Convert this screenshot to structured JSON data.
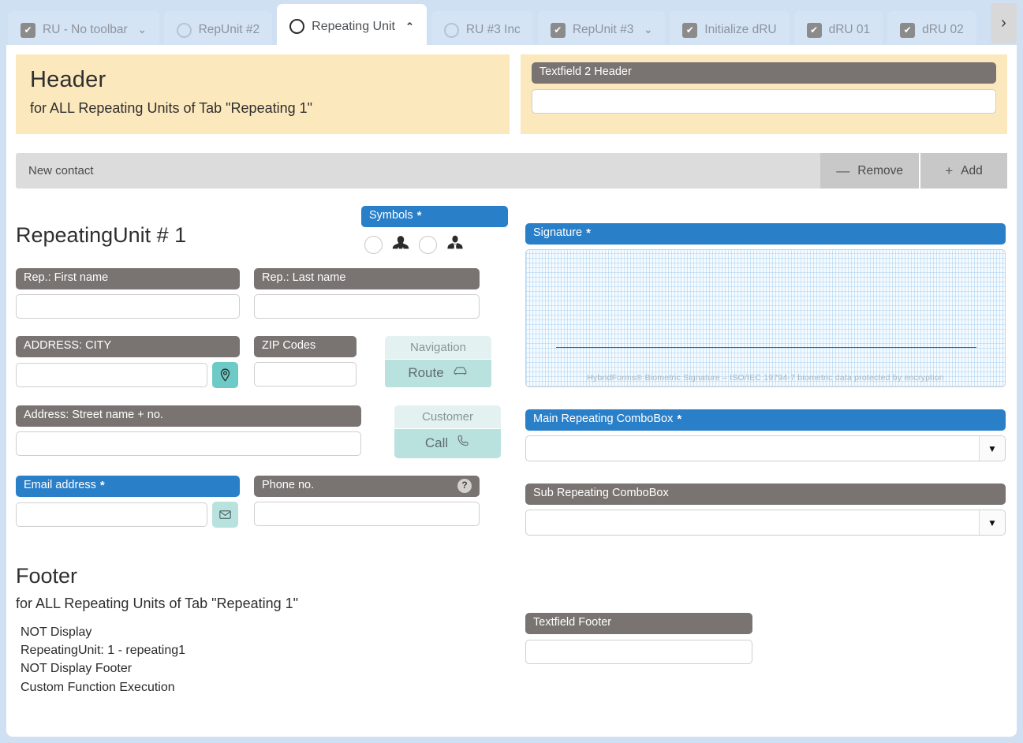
{
  "tabs": [
    {
      "label": "RU - No toolbar",
      "mark": "checkbox-checked-icon",
      "chevron": "chevron-down-icon",
      "active": false
    },
    {
      "label": "RepUnit #2",
      "mark": "circle-icon",
      "chevron": "",
      "active": false
    },
    {
      "label": "Repeating Unit",
      "mark": "circle-icon",
      "chevron": "chevron-up-icon",
      "active": true
    },
    {
      "label": "RU #3 Inc",
      "mark": "circle-icon",
      "chevron": "",
      "active": false
    },
    {
      "label": "RepUnit #3",
      "mark": "checkbox-checked-icon",
      "chevron": "chevron-down-icon",
      "active": false
    },
    {
      "label": "Initialize dRU",
      "mark": "checkbox-checked-icon",
      "chevron": "",
      "active": false
    },
    {
      "label": "dRU 01",
      "mark": "checkbox-checked-icon",
      "chevron": "",
      "active": false
    },
    {
      "label": "dRU 02",
      "mark": "checkbox-checked-icon",
      "chevron": "",
      "active": false
    }
  ],
  "tabbar": {
    "scroll_right_icon": "chevron-right-icon",
    "checkbox_glyph": "✔"
  },
  "header": {
    "title": "Header",
    "subtitle": "for ALL Repeating Units of Tab \"Repeating 1\"",
    "textfield2": {
      "label": "Textfield 2 Header",
      "value": "",
      "placeholder": ""
    }
  },
  "repeat_toolbar": {
    "title": "New contact",
    "remove_label": "Remove",
    "remove_icon": "minus-icon",
    "remove_glyph": "—",
    "add_label": "Add",
    "add_icon": "plus-icon",
    "add_glyph": "+"
  },
  "unit": {
    "title": "RepeatingUnit # 1",
    "symbols": {
      "label": "Symbols",
      "required": "*",
      "options": [
        {
          "icon": "female-person-icon",
          "selected": false
        },
        {
          "icon": "male-person-icon",
          "selected": false
        }
      ]
    },
    "first_name": {
      "label": "Rep.: First name",
      "value": ""
    },
    "last_name": {
      "label": "Rep.: Last name",
      "value": ""
    },
    "city": {
      "label": "ADDRESS: CITY",
      "value": "",
      "button_icon": "map-pin-icon"
    },
    "zip": {
      "label": "ZIP Codes",
      "value": ""
    },
    "navigation": {
      "top_label": "Navigation",
      "action_label": "Route",
      "icon": "car-icon"
    },
    "street": {
      "label": "Address: Street name + no.",
      "value": ""
    },
    "customer": {
      "top_label": "Customer",
      "action_label": "Call",
      "icon": "phone-icon"
    },
    "email": {
      "label": "Email address",
      "required": "*",
      "value": "",
      "button_icon": "mail-icon"
    },
    "phone": {
      "label": "Phone no.",
      "value": "",
      "help_icon": "help-icon",
      "help_glyph": "?"
    }
  },
  "right": {
    "signature": {
      "label": "Signature",
      "required": "*",
      "footer_text": "HybridForms® Biometric Signature  –  ISO/IEC 19794-7 biometric data protected by encryption"
    },
    "main_combo": {
      "label": "Main Repeating ComboBox",
      "required": "*",
      "value": "",
      "arrow_icon": "chevron-down-icon",
      "arrow_glyph": "▼"
    },
    "sub_combo": {
      "label": "Sub Repeating ComboBox",
      "required": "",
      "value": "",
      "arrow_icon": "chevron-down-icon",
      "arrow_glyph": "▼"
    }
  },
  "footer": {
    "title": "Footer",
    "subtitle": "for ALL Repeating Units of Tab \"Repeating 1\"",
    "lines": [
      "NOT Display",
      "RepeatingUnit: 1 - repeating1",
      "NOT Display Footer",
      "Custom Function Execution"
    ],
    "textfield": {
      "label": "Textfield Footer",
      "value": ""
    }
  },
  "colors": {
    "page_background": "#cfe0f3",
    "tab_inactive": "#d4e4f5",
    "banner_cream": "#fce8bd",
    "label_gray": "#797471",
    "label_blue": "#2a7fc9",
    "toolbar_gray": "#dcdcdc",
    "teal_button": "#6ecac7",
    "mint_button": "#b9e2df",
    "mint_light": "#e3f2f1"
  }
}
